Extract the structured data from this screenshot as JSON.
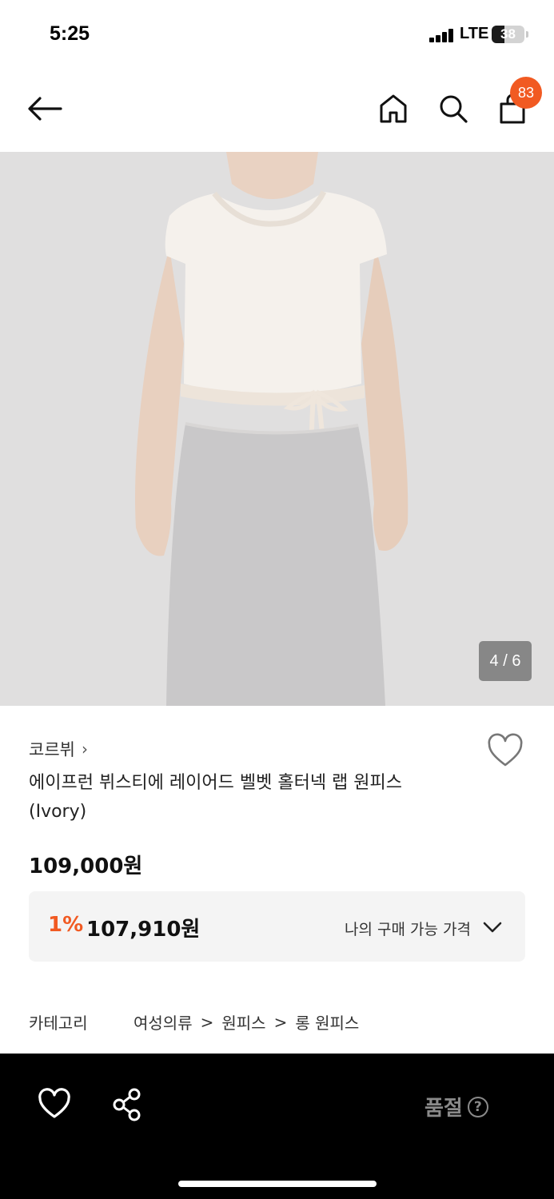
{
  "status_bar": {
    "time": "5:25",
    "network": "LTE",
    "battery": "38",
    "battery_level": 0.38
  },
  "header": {
    "cart_count": "83",
    "icons": [
      "back-arrow-icon",
      "home-icon",
      "search-icon",
      "shopping-bag-icon"
    ],
    "badge_color": "#f15a22"
  },
  "gallery": {
    "counter": "4 / 6"
  },
  "product": {
    "brand": "코르뷔",
    "name_line1": "에이프런 뷔스티에 레이어드 벨벳 홀터넥 랩 원피스",
    "name_line2": "(Ivory)",
    "price": "109,000원"
  },
  "my_price": {
    "discount_rate": "1%",
    "discounted_price": "107,910원",
    "label": "나의 구매 가능 가격"
  },
  "category": {
    "label": "카테고리",
    "path": [
      "여성의류",
      "원피스",
      "롱 원피스"
    ]
  },
  "bottom_bar": {
    "status_label": "품절",
    "help_symbol": "?",
    "icons": [
      "heart-outline-icon",
      "share-icon",
      "help-circle-icon"
    ]
  },
  "colors": {
    "accent": "#f15a22",
    "bottom_bar": "#000000",
    "soldout_text": "#8a8a8a"
  }
}
